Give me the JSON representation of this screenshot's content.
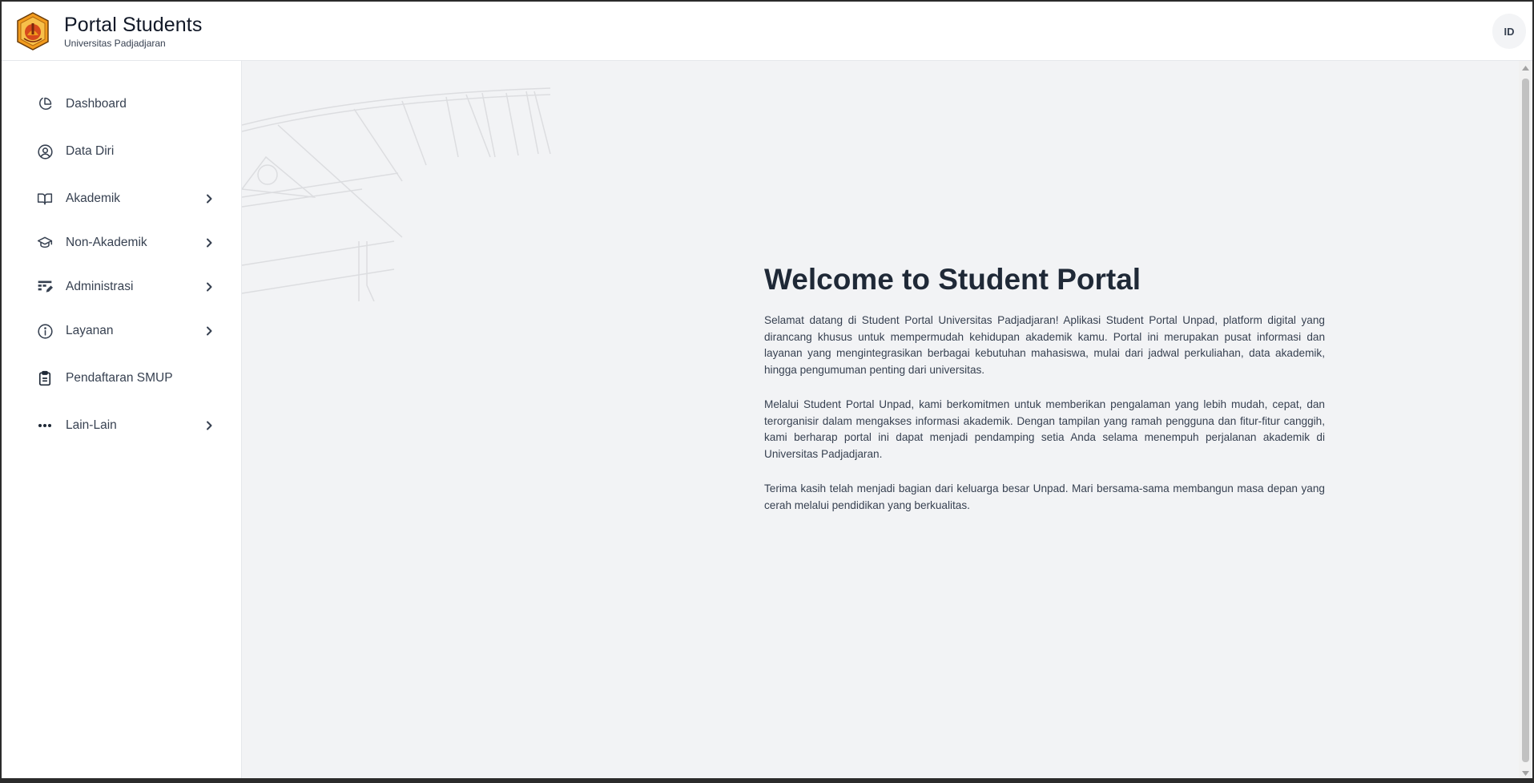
{
  "header": {
    "title": "Portal Students",
    "subtitle": "Universitas Padjadjaran",
    "logo_icon": "unpad-crest-icon",
    "language_label": "ID"
  },
  "sidebar": {
    "items": [
      {
        "label": "Dashboard",
        "icon": "pie-chart-icon",
        "has_submenu": false
      },
      {
        "label": "Data Diri",
        "icon": "user-circle-icon",
        "has_submenu": false
      },
      {
        "label": "Akademik",
        "icon": "open-book-icon",
        "has_submenu": true
      },
      {
        "label": "Non-Akademik",
        "icon": "graduation-cap-icon",
        "has_submenu": true
      },
      {
        "label": "Administrasi",
        "icon": "table-edit-icon",
        "has_submenu": true
      },
      {
        "label": "Layanan",
        "icon": "info-icon",
        "has_submenu": true
      },
      {
        "label": "Pendaftaran SMUP",
        "icon": "clipboard-icon",
        "has_submenu": false
      },
      {
        "label": "Lain-Lain",
        "icon": "more-dots-icon",
        "has_submenu": true
      }
    ]
  },
  "main": {
    "title": "Welcome to Student Portal",
    "paragraphs": [
      "Selamat datang di Student Portal Universitas Padjadjaran! Aplikasi Student Portal Unpad, platform digital yang dirancang khusus untuk mempermudah kehidupan akademik kamu. Portal ini merupakan pusat informasi dan layanan yang mengintegrasikan berbagai kebutuhan mahasiswa, mulai dari jadwal perkuliahan, data akademik, hingga pengumuman penting dari universitas.",
      "Melalui Student Portal Unpad, kami berkomitmen untuk memberikan pengalaman yang lebih mudah, cepat, dan terorganisir dalam mengakses informasi akademik. Dengan tampilan yang ramah pengguna dan fitur-fitur canggih, kami berharap portal ini dapat menjadi pendamping setia Anda selama menempuh perjalanan akademik di Universitas Padjadjaran.",
      "Terima kasih telah menjadi bagian dari keluarga besar Unpad. Mari bersama-sama membangun masa depan yang cerah melalui pendidikan yang berkualitas."
    ]
  },
  "colors": {
    "main_background": "#f2f3f5",
    "logo_orange": "#f29b1d",
    "logo_red": "#c0392b",
    "text_dark": "#1f2937"
  }
}
